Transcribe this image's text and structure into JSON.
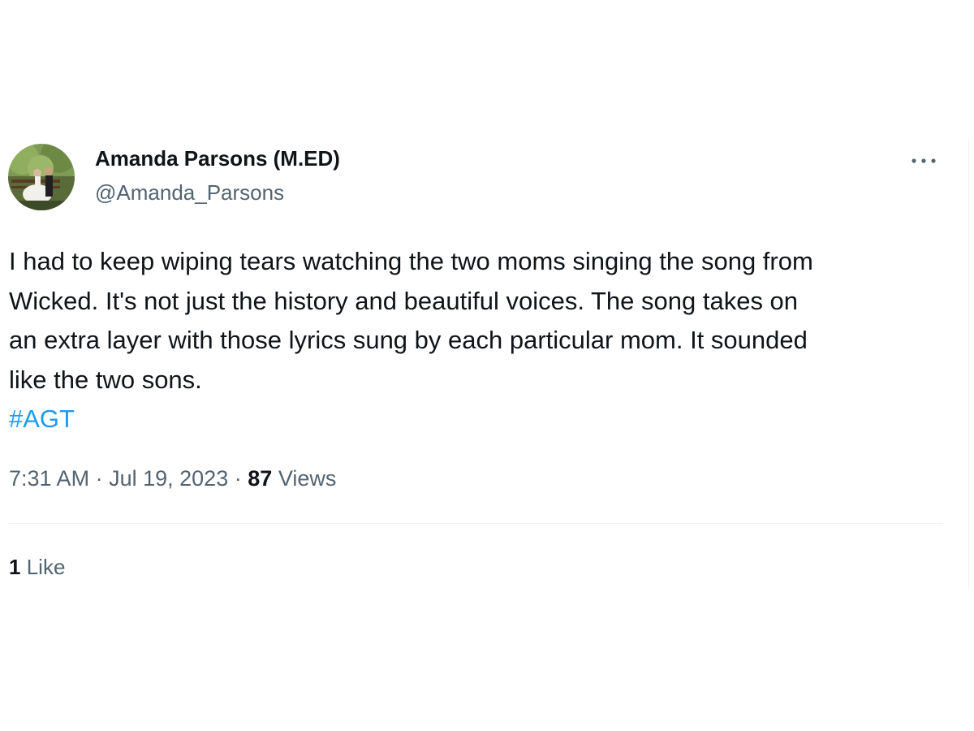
{
  "tweet": {
    "author": {
      "display_name": "Amanda Parsons (M.ED)",
      "handle": "@Amanda_Parsons",
      "avatar_icon": "profile-photo"
    },
    "more_icon": "more-horizontal-icon",
    "text_lines": [
      "I had to keep wiping tears watching the two moms singing the song from",
      "Wicked. It's not just the history and beautiful voices. The song takes on",
      "an extra layer with those lyrics sung by each particular mom. It sounded",
      "like the two sons."
    ],
    "hashtag": "#AGT",
    "time": "7:31 AM",
    "separator": "·",
    "date": "Jul 19, 2023",
    "views_count": "87",
    "views_label": "Views",
    "likes_count": "1",
    "likes_label": "Like"
  },
  "colors": {
    "text": "#0f1419",
    "secondary": "#536471",
    "link": "#1d9bf0",
    "divider": "#eff3f4"
  }
}
